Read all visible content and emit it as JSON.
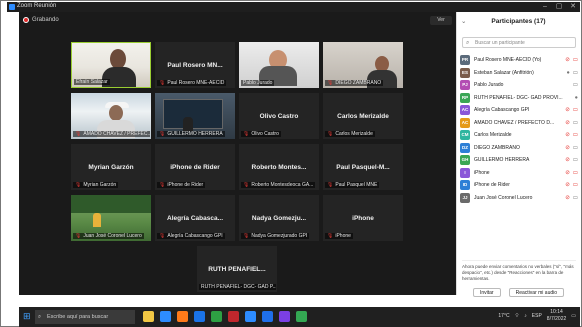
{
  "window": {
    "app_title": "Zoom Reunión"
  },
  "meeting": {
    "recording_label": "Grabando",
    "view_label": "Ver",
    "tiles": [
      {
        "id": "t1",
        "center_name": "",
        "label": "Efraín Salazar",
        "mic_muted": false,
        "active": true,
        "video": "a"
      },
      {
        "id": "t2",
        "center_name": "Paul Rosero MN...",
        "label": "Paul Rosero MNE-AECID",
        "mic_muted": true,
        "active": false,
        "video": ""
      },
      {
        "id": "t3",
        "center_name": "",
        "label": "Pablo Jurado",
        "mic_muted": false,
        "active": false,
        "video": "c"
      },
      {
        "id": "t4",
        "center_name": "",
        "label": "DIEGO ZAMBRANO",
        "mic_muted": true,
        "active": false,
        "video": "f"
      },
      {
        "id": "t5",
        "center_name": "",
        "label": "AMADO CHAVEZ / PREFEC...",
        "mic_muted": true,
        "active": false,
        "video": "d"
      },
      {
        "id": "t6",
        "center_name": "",
        "label": "GUILLERMO HERRERA",
        "mic_muted": true,
        "active": false,
        "video": "e"
      },
      {
        "id": "t7",
        "center_name": "Olivo Castro",
        "label": "Olivo Castro",
        "mic_muted": true,
        "active": false,
        "video": ""
      },
      {
        "id": "t8",
        "center_name": "Carlos Merizalde",
        "label": "Carlos Merizalde",
        "mic_muted": true,
        "active": false,
        "video": ""
      },
      {
        "id": "t9",
        "center_name": "Myrian Garzón",
        "label": "Myrian Garzón",
        "mic_muted": true,
        "active": false,
        "video": ""
      },
      {
        "id": "t10",
        "center_name": "iPhone de Rider",
        "label": "iPhone de Rider",
        "mic_muted": true,
        "active": false,
        "video": ""
      },
      {
        "id": "t11",
        "center_name": "Roberto Montes...",
        "label": "Roberto Montesdeoca GA...",
        "mic_muted": true,
        "active": false,
        "video": ""
      },
      {
        "id": "t12",
        "center_name": "Paul Pasquel-M...",
        "label": "Paul Pasquel MNE",
        "mic_muted": true,
        "active": false,
        "video": ""
      },
      {
        "id": "t13",
        "center_name": "",
        "label": "Juan José Coronel Lucero",
        "mic_muted": true,
        "active": false,
        "video": "g"
      },
      {
        "id": "t14",
        "center_name": "Alegría Cabasca...",
        "label": "Alegría Cabascango GPI",
        "mic_muted": true,
        "active": false,
        "video": ""
      },
      {
        "id": "t15",
        "center_name": "Nadya Gomezju...",
        "label": "Nadya Gomezjurado GPI",
        "mic_muted": true,
        "active": false,
        "video": ""
      },
      {
        "id": "t16",
        "center_name": "iPhone",
        "label": "iPhone",
        "mic_muted": true,
        "active": false,
        "video": ""
      },
      {
        "id": "t17",
        "center_name": "RUTH PEÑAFIEL...",
        "label": "RUTH PEÑAFIEL- DGC- GAD P...",
        "mic_muted": false,
        "active": false,
        "video": ""
      }
    ]
  },
  "participants": {
    "title": "Participantes (17)",
    "search_placeholder": "Buscar un participante",
    "items": [
      {
        "initials": "PR",
        "name": "Paul Rosero MNE-AECID (Yo)",
        "color": "#5b6b7b",
        "mic": "muted",
        "cam": "off"
      },
      {
        "initials": "ES",
        "name": "Esteban Salazar (Anfitrión)",
        "color": "#7a5c4a",
        "mic": "on",
        "cam": "on"
      },
      {
        "initials": "PJ",
        "name": "Pablo Jurado",
        "color": "#b34db3",
        "mic": "none",
        "cam": "on"
      },
      {
        "initials": "RP",
        "name": "RUTH PEÑAFIEL- DGC- GAD PROVI...",
        "color": "#3aa655",
        "mic": "on",
        "cam": "none"
      },
      {
        "initials": "AC",
        "name": "Alegría Cabascango GPI",
        "color": "#8a56d8",
        "mic": "muted",
        "cam": "off"
      },
      {
        "initials": "AC",
        "name": "AMADO CHAVEZ / PREFECTO D...",
        "color": "#e59a1a",
        "mic": "muted",
        "cam": "on"
      },
      {
        "initials": "CM",
        "name": "Carlos Merizalde",
        "color": "#2fb6a0",
        "mic": "muted",
        "cam": "off"
      },
      {
        "initials": "DZ",
        "name": "DIEGO ZAMBRANO",
        "color": "#2d7fd6",
        "mic": "muted",
        "cam": "on"
      },
      {
        "initials": "GH",
        "name": "GUILLERMO HERRERA",
        "color": "#3aa655",
        "mic": "muted",
        "cam": "on"
      },
      {
        "initials": "I",
        "name": "iPhone",
        "color": "#8a56d8",
        "mic": "muted",
        "cam": "off"
      },
      {
        "initials": "ID",
        "name": "iPhone de Rider",
        "color": "#2d7fd6",
        "mic": "muted",
        "cam": "off"
      },
      {
        "initials": "JJ",
        "name": "Juan José Coronel Lucero",
        "color": "#6a6a6a",
        "mic": "muted",
        "cam": "on"
      }
    ],
    "notice": "Ahora puede enviar comentarios no verbales (\"sí\", \"más despacio\", etc.) desde \"Reacciones\" en la barra de herramientas.",
    "invite_label": "Invitar",
    "unmute_label": "Reactivar mi audio"
  },
  "taskbar": {
    "search_placeholder": "Escribe aquí para buscar",
    "temperature": "17°C",
    "language": "ESP",
    "time": "10:14",
    "date": "8/7/2022",
    "app_colors": [
      "#f2c744",
      "#2d8cff",
      "#ff7a1a",
      "#1a73e8",
      "#2ea043",
      "#c1272d",
      "#2d8cff",
      "#1f6feb",
      "#7b3fe4",
      "#34a853"
    ]
  },
  "colors": {
    "accent_active": "#9acd32",
    "muted_red": "#e53935",
    "zoom_blue": "#2d8cff"
  }
}
